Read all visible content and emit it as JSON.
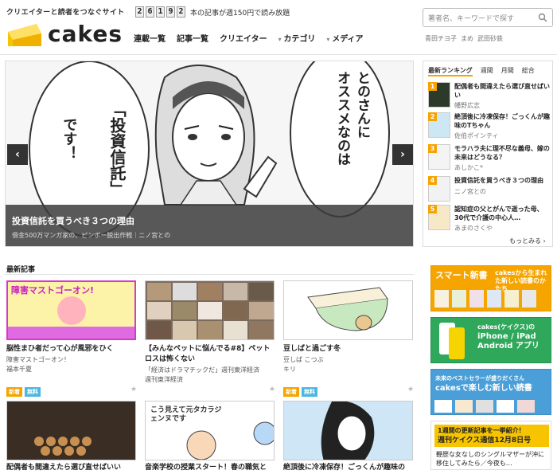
{
  "header": {
    "tagline": "クリエイターと読者をつなぐサイト",
    "logo_text": "cakes",
    "counter_digits": [
      "2",
      "6",
      "1",
      "9",
      "2"
    ],
    "counter_text": "本の記事が週150円で読み放題",
    "nav": [
      {
        "label": "連載一覧",
        "dropdown": false
      },
      {
        "label": "記事一覧",
        "dropdown": false
      },
      {
        "label": "クリエイター",
        "dropdown": false
      },
      {
        "label": "カテゴリ",
        "dropdown": true
      },
      {
        "label": "メディア",
        "dropdown": true
      }
    ],
    "search_placeholder": "著者名、キーワードで探す",
    "search_links": [
      "青田チヨ子",
      "まめ",
      "武田砂鉄"
    ]
  },
  "hero": {
    "title": "投資信託を買うべき３つの理由",
    "subtitle": "借金500万マンガ家の、ピンボー脱出作戦｜ニノ宮との",
    "bubble_left": "「投資信託」です！",
    "bubble_right": "とのさんにオススメなのは",
    "prev_label": "‹",
    "next_label": "›"
  },
  "ranking": {
    "heading": "最新ランキング",
    "tabs": [
      "週間",
      "月間",
      "総合"
    ],
    "items": [
      {
        "num": "1",
        "title": "配偶者も間違えたら選び直せばいい",
        "author": "幡野広志"
      },
      {
        "num": "2",
        "title": "絶頂後に冷凍保存！ごっくんが趣味のTちゃん",
        "author": "佐伯ポインティ"
      },
      {
        "num": "3",
        "title": "モラハラ夫に理不尽な義母、嫁の未来はどうなる？",
        "author": "あしかこ*"
      },
      {
        "num": "4",
        "title": "投資信託を買うべき３つの理由",
        "author": "ニノ宮との"
      },
      {
        "num": "5",
        "title": "認知症の父とがんで逝った母、30代で介護の中心人…",
        "author": "あまのさくや"
      }
    ],
    "more": "もっとみる ›"
  },
  "latest": {
    "heading": "最新記事",
    "articles": [
      {
        "title": "脳性まひ者だって心が風邪をひく",
        "sub1": "障害マストゴーオン！",
        "sub2": "福本千夏",
        "img_text": "障害マストゴーオン!"
      },
      {
        "title": "【みんなペットに悩んでる#8】ペットロスは怖くない",
        "sub1": "「経済はドラマチックだ」週刊東洋経済",
        "sub2": "週刊東洋経済",
        "img_text": ""
      },
      {
        "title": "豆しばと過ごす冬",
        "sub1": "豆しば こつぶ",
        "sub2": "キリ",
        "img_text": ""
      }
    ],
    "tags": {
      "new": "新着",
      "free": "無料"
    },
    "articles2": [
      {
        "title": "配偶者も間違えたら選び直せばいい",
        "img_text": ""
      },
      {
        "title": "音楽学校の授業スタート！春の職気と",
        "img_text": "こう見えて元タカラジェンヌです"
      },
      {
        "title": "絶頂後に冷凍保存！ごっくんが趣味の",
        "img_text": ""
      }
    ]
  },
  "banners": [
    {
      "title": "スマート新書",
      "text": "cakesから生まれた新しい読書のかたち"
    },
    {
      "title": "cakes(ケイクス)の",
      "text": "iPhone / iPad Android アプリ"
    },
    {
      "title": "未来のベストセラーが盛りだくさん",
      "text": "cakesで楽しむ新しい読書"
    },
    {
      "title": "1週間の更新記事を一挙紹介！",
      "text": "週刊ケイクス通信12月8日号",
      "sub": "鞭歴な女なしのシングルマザーが沖に移住してみたら／今夜も…"
    }
  ]
}
